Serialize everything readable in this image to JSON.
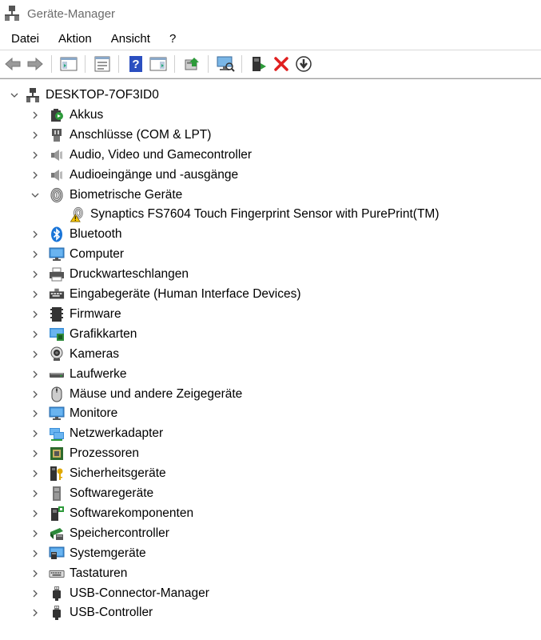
{
  "window": {
    "title": "Geräte-Manager"
  },
  "menu": [
    "Datei",
    "Aktion",
    "Ansicht",
    "?"
  ],
  "toolbar": [
    "back-icon",
    "forward-icon",
    "console-tree-icon",
    "properties-icon",
    "help-icon",
    "action-pane-icon",
    "update-driver-icon",
    "scan-hardware-icon",
    "enable-device-icon",
    "uninstall-device-icon",
    "download-driver-icon"
  ],
  "tree": {
    "root": "DESKTOP-7OF3ID0",
    "categories": [
      {
        "label": "Akkus",
        "icon": "battery-icon",
        "expanded": false
      },
      {
        "label": "Anschlüsse (COM & LPT)",
        "icon": "port-icon",
        "expanded": false
      },
      {
        "label": "Audio, Video und Gamecontroller",
        "icon": "speaker-icon",
        "expanded": false
      },
      {
        "label": "Audioeingänge und -ausgänge",
        "icon": "speaker-icon",
        "expanded": false
      },
      {
        "label": "Biometrische Geräte",
        "icon": "fingerprint-icon",
        "expanded": true,
        "children": [
          {
            "label": "Synaptics FS7604 Touch Fingerprint Sensor with PurePrint(TM)",
            "icon": "warning-fingerprint-icon"
          }
        ]
      },
      {
        "label": "Bluetooth",
        "icon": "bluetooth-icon",
        "expanded": false
      },
      {
        "label": "Computer",
        "icon": "computer-icon",
        "expanded": false
      },
      {
        "label": "Druckwarteschlangen",
        "icon": "printer-icon",
        "expanded": false
      },
      {
        "label": "Eingabegeräte (Human Interface Devices)",
        "icon": "hid-icon",
        "expanded": false
      },
      {
        "label": "Firmware",
        "icon": "firmware-icon",
        "expanded": false
      },
      {
        "label": "Grafikkarten",
        "icon": "display-adapter-icon",
        "expanded": false
      },
      {
        "label": "Kameras",
        "icon": "camera-icon",
        "expanded": false
      },
      {
        "label": "Laufwerke",
        "icon": "drive-icon",
        "expanded": false
      },
      {
        "label": "Mäuse und andere Zeigegeräte",
        "icon": "mouse-icon",
        "expanded": false
      },
      {
        "label": "Monitore",
        "icon": "monitor-icon",
        "expanded": false
      },
      {
        "label": "Netzwerkadapter",
        "icon": "network-icon",
        "expanded": false
      },
      {
        "label": "Prozessoren",
        "icon": "processor-icon",
        "expanded": false
      },
      {
        "label": "Sicherheitsgeräte",
        "icon": "security-icon",
        "expanded": false
      },
      {
        "label": "Softwaregeräte",
        "icon": "software-device-icon",
        "expanded": false
      },
      {
        "label": "Softwarekomponenten",
        "icon": "software-component-icon",
        "expanded": false
      },
      {
        "label": "Speichercontroller",
        "icon": "storage-controller-icon",
        "expanded": false
      },
      {
        "label": "Systemgeräte",
        "icon": "system-device-icon",
        "expanded": false
      },
      {
        "label": "Tastaturen",
        "icon": "keyboard-icon",
        "expanded": false
      },
      {
        "label": "USB-Connector-Manager",
        "icon": "usb-icon",
        "expanded": false
      },
      {
        "label": "USB-Controller",
        "icon": "usb-icon",
        "expanded": false
      }
    ]
  }
}
